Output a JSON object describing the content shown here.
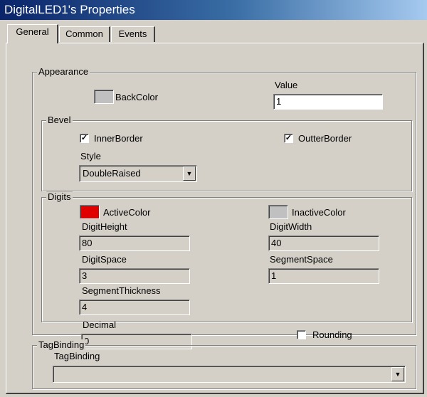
{
  "window": {
    "title": "DigitalLED1's Properties"
  },
  "tabs": [
    {
      "label": "General",
      "active": true
    },
    {
      "label": "Common",
      "active": false
    },
    {
      "label": "Events",
      "active": false
    }
  ],
  "appearance": {
    "legend": "Appearance",
    "backcolor": {
      "label": "BackColor",
      "color": "#c0c0c0"
    },
    "value": {
      "label": "Value",
      "value": "1"
    }
  },
  "bevel": {
    "legend": "Bevel",
    "inner_border": {
      "label": "InnerBorder",
      "checked": true,
      "mark": "✓"
    },
    "outter_border": {
      "label": "OutterBorder",
      "checked": true,
      "mark": "✓"
    },
    "style": {
      "label": "Style",
      "value": "DoubleRaised"
    }
  },
  "digits": {
    "legend": "Digits",
    "active_color": {
      "label": "ActiveColor",
      "color": "#e00000"
    },
    "inactive_color": {
      "label": "InactiveColor",
      "color": "#c0c0c0"
    },
    "digit_height": {
      "label": "DigitHeight",
      "value": "80"
    },
    "digit_width": {
      "label": "DigitWidth",
      "value": "40"
    },
    "digit_space": {
      "label": "DigitSpace",
      "value": "3"
    },
    "segment_space": {
      "label": "SegmentSpace",
      "value": "1"
    },
    "segment_thickness": {
      "label": "SegmentThickness",
      "value": "4"
    }
  },
  "decimal": {
    "label": "Decimal",
    "value": "0"
  },
  "rounding": {
    "label": "Rounding",
    "checked": false,
    "mark": ""
  },
  "tagbinding": {
    "legend": "TagBinding",
    "label": "TagBinding",
    "value": ""
  },
  "icons": {
    "dropdown": "▼"
  }
}
